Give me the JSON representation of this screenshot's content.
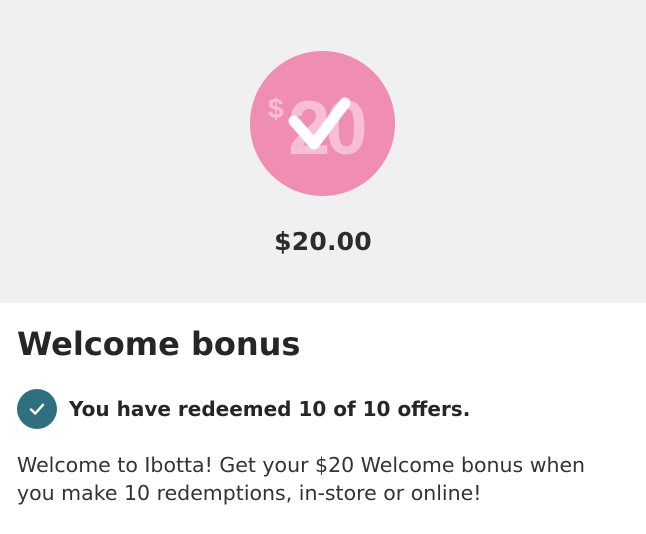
{
  "hero": {
    "badge_dollar": "$",
    "badge_value": "20",
    "amount": "$20.00"
  },
  "content": {
    "title": "Welcome bonus",
    "status": "You have redeemed 10 of 10 offers.",
    "description": "Welcome to Ibotta! Get your $20 Welcome bonus when you make 10 redemptions, in-store or online!"
  },
  "colors": {
    "hero_background": "#f0f0f0",
    "badge_pink": "#ef8db3",
    "check_teal": "#2f6f7f",
    "text_dark": "#262626"
  },
  "icons": {
    "badge": "dollar-badge-check-icon",
    "status": "check-circle-icon"
  }
}
